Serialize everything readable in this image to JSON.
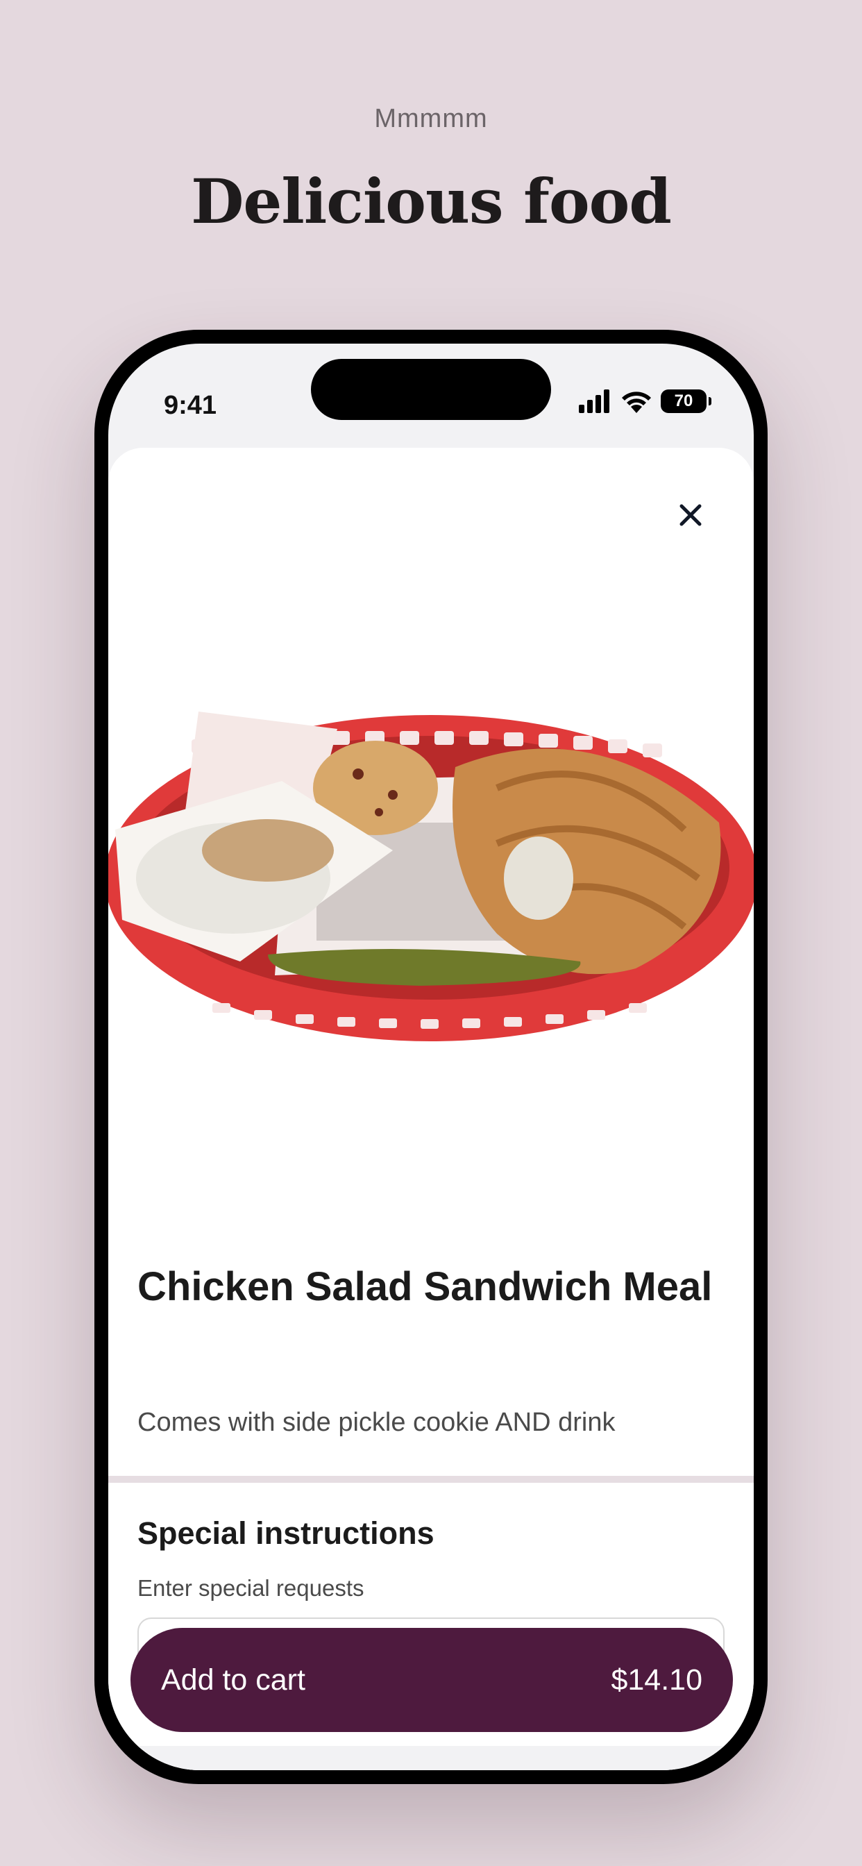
{
  "intro": {
    "eyebrow": "Mmmmm",
    "headline": "Delicious food"
  },
  "status_bar": {
    "time": "9:41",
    "battery": "70",
    "icons": [
      "signal-icon",
      "wifi-icon",
      "battery-icon"
    ]
  },
  "item": {
    "image_alt": "food-basket-image",
    "title": "Chicken Salad Sandwich Meal",
    "description": "Comes with side pickle cookie AND drink"
  },
  "special_instructions": {
    "heading": "Special instructions",
    "subtitle": "Enter special requests",
    "value": ""
  },
  "cart": {
    "label": "Add to cart",
    "price": "$14.10"
  },
  "colors": {
    "background": "#e4d8de",
    "accent": "#4e1a3e",
    "basket_red": "#e03a3a"
  }
}
